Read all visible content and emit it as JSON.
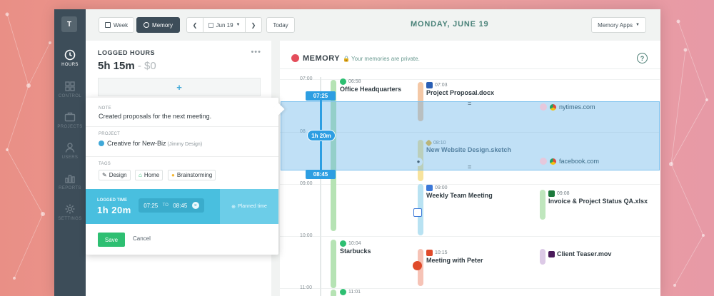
{
  "nav": {
    "avatar": "T",
    "items": [
      {
        "label": "HOURS",
        "icon": "clock-icon"
      },
      {
        "label": "CONTROL",
        "icon": "grid-icon"
      },
      {
        "label": "PROJECTS",
        "icon": "briefcase-icon"
      },
      {
        "label": "USERS",
        "icon": "user-icon"
      },
      {
        "label": "REPORTS",
        "icon": "chart-icon"
      },
      {
        "label": "SETTINGS",
        "icon": "gear-icon"
      }
    ]
  },
  "toolbar": {
    "week": "Week",
    "memory": "Memory",
    "date": "Jun 19",
    "today": "Today",
    "title": "MONDAY, JUNE 19",
    "apps": "Memory Apps"
  },
  "logged": {
    "title": "LOGGED HOURS",
    "hours": "5h 15m",
    "sep": " - ",
    "money": "$0",
    "add": "+"
  },
  "popup": {
    "note_tag": "NOTE",
    "note": "Created proposals for the next meeting.",
    "project_tag": "PROJECT",
    "project": "Creative for New-Biz",
    "project_client": "(Jimmy Design)",
    "tags_tag": "TAGS",
    "tags": [
      "Design",
      "Home",
      "Brainstorming"
    ],
    "logged_tag": "LOGGED TIME",
    "logged_value": "1h 20m",
    "from": "07:25",
    "to_label": "TO",
    "to": "08:45",
    "clear": "×",
    "planned": "Planned time",
    "save": "Save",
    "cancel": "Cancel"
  },
  "memory": {
    "title": "MEMORY",
    "private": "Your memories are private.",
    "help": "?",
    "times": [
      "07:00",
      "08",
      "09:00",
      "10:00",
      "11:00"
    ],
    "selection": {
      "start": "07:25",
      "duration": "1h 20m",
      "end": "08:45"
    },
    "events": [
      {
        "time": "06:58",
        "name": "Office Headquarters",
        "icon": "location-icon",
        "color": "#2ebf72"
      },
      {
        "time": "07:03",
        "name": "Project Proposal.docx",
        "icon": "word-icon",
        "color": "#2b5fb4"
      },
      {
        "time": "08:10",
        "name": "New Website Design.sketch",
        "icon": "sketch-icon",
        "color": "#f5b731"
      },
      {
        "time": "09:00",
        "name": "Weekly Team Meeting",
        "icon": "calendar-icon",
        "color": "#3b78d8"
      },
      {
        "time": "09:08",
        "name": "Invoice & Project Status QA.xlsx",
        "icon": "excel-icon",
        "color": "#1d7a3c"
      },
      {
        "time": "10:04",
        "name": "Starbucks",
        "icon": "location-icon",
        "color": "#2ebf72"
      },
      {
        "time": "10:15",
        "name": "Meeting with Peter",
        "icon": "office-icon",
        "color": "#e04a2a"
      },
      {
        "name": "Client Teaser.mov",
        "icon": "premiere-icon",
        "color": "#4a1a5a"
      },
      {
        "time": "11:01",
        "icon": "location-icon",
        "color": "#2ebf72"
      }
    ],
    "urls": [
      "nytimes.com",
      "facebook.com"
    ],
    "equals": "="
  }
}
